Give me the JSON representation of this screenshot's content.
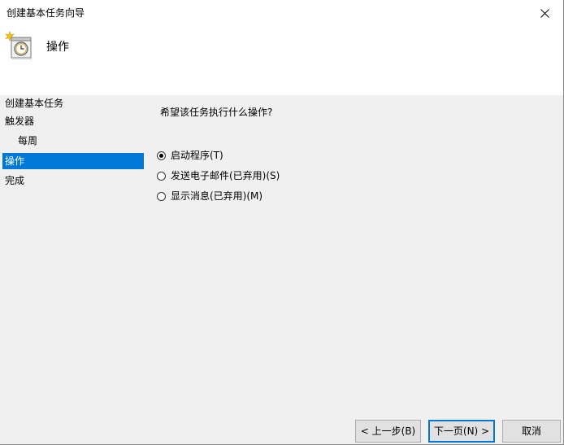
{
  "window": {
    "title": "创建基本任务向导",
    "close_glyph": "✕"
  },
  "header": {
    "icon": "task-clock-icon",
    "title": "操作"
  },
  "sidebar": {
    "items": [
      {
        "label": "创建基本任务",
        "selected": false,
        "sub": false
      },
      {
        "label": "触发器",
        "selected": false,
        "sub": false
      },
      {
        "label": "每周",
        "selected": false,
        "sub": true
      },
      {
        "label": "操作",
        "selected": true,
        "sub": false
      },
      {
        "label": "完成",
        "selected": false,
        "sub": false
      }
    ]
  },
  "main": {
    "question": "希望该任务执行什么操作?",
    "options": [
      {
        "label": "启动程序(T)",
        "checked": true
      },
      {
        "label": "发送电子邮件(已弃用)(S)",
        "checked": false
      },
      {
        "label": "显示消息(已弃用)(M)",
        "checked": false
      }
    ]
  },
  "buttons": {
    "back": "< 上一步(B)",
    "next": "下一页(N) >",
    "cancel": "取消"
  },
  "colors": {
    "accent": "#0078d7",
    "header_bg": "#ffffff",
    "body_bg": "#f0f0f0"
  }
}
